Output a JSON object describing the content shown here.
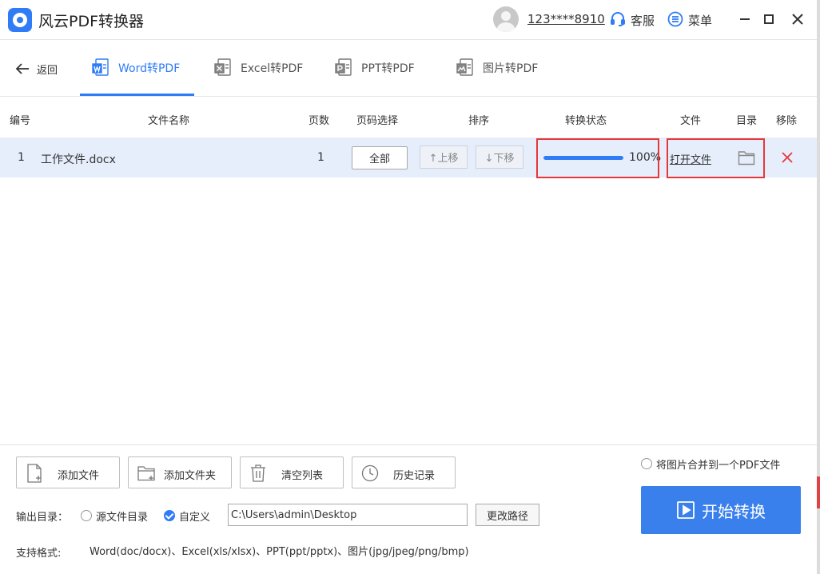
{
  "app": {
    "title": "风云PDF转换器"
  },
  "header": {
    "account": "123****8910",
    "service_label": "客服",
    "menu_label": "菜单"
  },
  "nav": {
    "back_label": "返回",
    "tabs": [
      {
        "label": "Word转PDF",
        "active": true,
        "icon": "word-file-icon"
      },
      {
        "label": "Excel转PDF",
        "active": false,
        "icon": "excel-file-icon"
      },
      {
        "label": "PPT转PDF",
        "active": false,
        "icon": "ppt-file-icon"
      },
      {
        "label": "图片转PDF",
        "active": false,
        "icon": "image-file-icon"
      }
    ]
  },
  "table": {
    "columns": [
      "编号",
      "文件名称",
      "页数",
      "页码选择",
      "排序",
      "转换状态",
      "文件",
      "目录",
      "移除"
    ],
    "rows": [
      {
        "index": "1",
        "filename": "工作文件.docx",
        "pages": "1",
        "page_select": "全部",
        "move_up": "↑上移",
        "move_down": "↓下移",
        "progress": 100,
        "progress_text": "100%",
        "open_file": "打开文件"
      }
    ]
  },
  "toolbar": {
    "add_file": "添加文件",
    "add_folder": "添加文件夹",
    "clear_list": "清空列表",
    "history": "历史记录"
  },
  "options": {
    "merge_images_label": "将图片合并到一个PDF文件",
    "merge_images_checked": false,
    "output_label": "输出目录：",
    "source_dir_label": "源文件目录",
    "custom_label": "自定义",
    "custom_checked": true,
    "output_path": "C:\\Users\\admin\\Desktop",
    "change_path": "更改路径"
  },
  "start_button": "开始转换",
  "formats": {
    "label": "支持格式:",
    "value": "Word(doc/docx)、Excel(xls/xlsx)、PPT(ppt/pptx)、图片(jpg/jpeg/png/bmp)"
  },
  "colors": {
    "accent": "#2f7cf6",
    "highlight": "#e5383b",
    "row_selected": "#e6eefb"
  }
}
